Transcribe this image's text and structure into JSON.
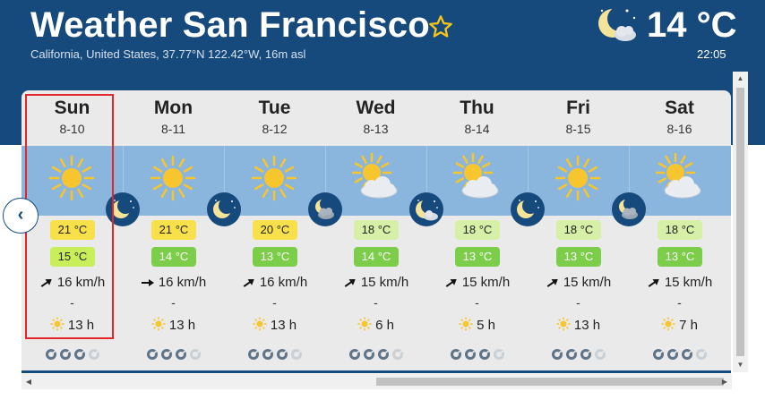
{
  "header": {
    "title": "Weather San Francisco",
    "subtitle": "California, United States, 37.77°N 122.42°W, 16m asl",
    "current_temp": "14 °C",
    "current_time": "22:05",
    "current_icon": "moon-stars-cloud-icon",
    "favorite_icon": "star-outline-icon"
  },
  "colors": {
    "header_bg": "#174a7c",
    "sky_bg": "#8ab6de",
    "temp_yellow": "#f7e04a",
    "temp_lightgreen": "#d6f0a8",
    "temp_lime": "#c8ef5a",
    "temp_green": "#7ccd4a",
    "selection": "#e3262a"
  },
  "nav": {
    "prev_label": "‹"
  },
  "days": [
    {
      "name": "Sun",
      "date": "8-10",
      "icon": "sun-icon",
      "tmax": "21 °C",
      "tmin": "15 °C",
      "wind": "16 km/h",
      "precip": "-",
      "sun": "13 h"
    },
    {
      "name": "Mon",
      "date": "8-11",
      "icon": "sun-icon",
      "tmax": "21 °C",
      "tmin": "14 °C",
      "wind": "16 km/h",
      "precip": "-",
      "sun": "13 h"
    },
    {
      "name": "Tue",
      "date": "8-12",
      "icon": "sun-icon",
      "tmax": "20 °C",
      "tmin": "13 °C",
      "wind": "16 km/h",
      "precip": "-",
      "sun": "13 h"
    },
    {
      "name": "Wed",
      "date": "8-13",
      "icon": "sun-cloud-icon",
      "tmax": "18 °C",
      "tmin": "14 °C",
      "wind": "15 km/h",
      "precip": "-",
      "sun": "6 h"
    },
    {
      "name": "Thu",
      "date": "8-14",
      "icon": "sun-cloud-icon",
      "tmax": "18 °C",
      "tmin": "13 °C",
      "wind": "15 km/h",
      "precip": "-",
      "sun": "5 h"
    },
    {
      "name": "Fri",
      "date": "8-15",
      "icon": "sun-icon",
      "tmax": "18 °C",
      "tmin": "13 °C",
      "wind": "15 km/h",
      "precip": "-",
      "sun": "13 h"
    },
    {
      "name": "Sat",
      "date": "8-16",
      "icon": "sun-cloud-icon",
      "tmax": "18 °C",
      "tmin": "13 °C",
      "wind": "15 km/h",
      "precip": "-",
      "sun": "7 h"
    }
  ],
  "night_icons": [
    "moon-stars-icon",
    "moon-stars-icon",
    "moon-cloud-icon",
    "moon-stars-cloud-icon",
    "moon-stars-icon",
    "moon-cloud-icon"
  ]
}
